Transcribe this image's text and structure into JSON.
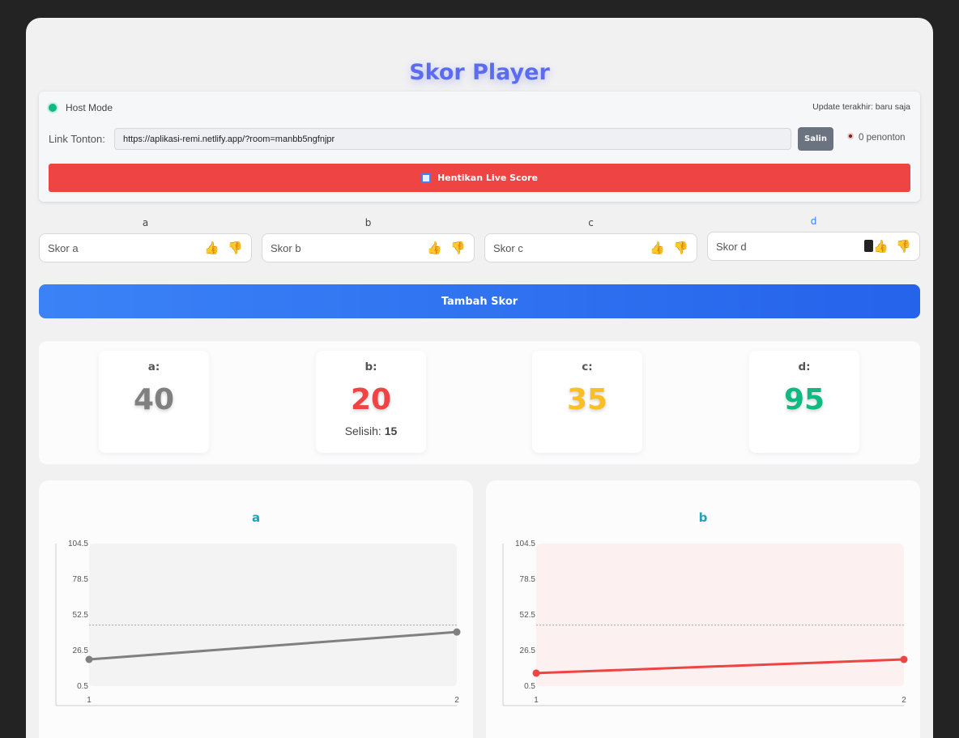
{
  "title": "Skor Player",
  "host": {
    "mode_label": "Host Mode",
    "update_text": "Update terakhir: baru saja",
    "link_label": "Link Tonton:",
    "link_value": "https://aplikasi-remi.netlify.app/?room=manbb5ngfnjpr",
    "copy_label": "Salin",
    "viewers_text": "0 penonton",
    "stop_label": "Hentikan Live Score"
  },
  "players": [
    {
      "name": "a",
      "placeholder": "Skor a",
      "total": "40",
      "color": "#808080"
    },
    {
      "name": "b",
      "placeholder": "Skor b",
      "total": "20",
      "color": "#ef4444",
      "diff_label": "Selisih:",
      "diff_value": "15"
    },
    {
      "name": "c",
      "placeholder": "Skor c",
      "total": "35",
      "color": "#fbbf24"
    },
    {
      "name": "d",
      "placeholder": "Skor d",
      "total": "95",
      "color": "#10b981"
    }
  ],
  "add_label": "Tambah Skor",
  "score_labels": [
    "a:",
    "b:",
    "c:",
    "d:"
  ],
  "chart_data": [
    {
      "type": "line",
      "title": "a",
      "x": [
        1,
        2
      ],
      "series": [
        {
          "values": [
            20,
            40
          ],
          "color": "#808080"
        }
      ],
      "yticks": [
        "104.5",
        "78.5",
        "52.5",
        "26.5",
        "0.5"
      ],
      "ylim": [
        0.5,
        104.5
      ],
      "reference_line": 45,
      "background": "#f3f3f3"
    },
    {
      "type": "line",
      "title": "b",
      "x": [
        1,
        2
      ],
      "series": [
        {
          "values": [
            10,
            20
          ],
          "color": "#ef4444"
        }
      ],
      "yticks": [
        "104.5",
        "78.5",
        "52.5",
        "26.5",
        "0.5"
      ],
      "ylim": [
        0.5,
        104.5
      ],
      "reference_line": 45,
      "background": "#fdf0f0"
    }
  ]
}
